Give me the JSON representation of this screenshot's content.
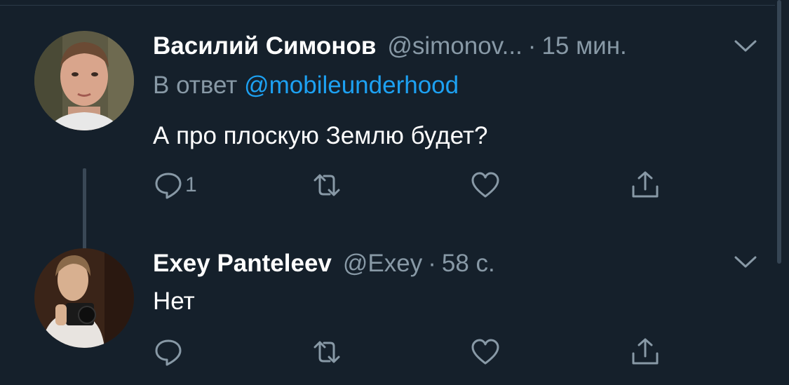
{
  "tweets": [
    {
      "author_name": "Василий Симонов",
      "author_handle": "@simonov...",
      "separator": "·",
      "time": "15 мин.",
      "reply_prefix": "В ответ",
      "reply_mention": "@mobileunderhood",
      "text": "А про плоскую Землю будет?",
      "reply_count": "1",
      "avatar": "person-photo-avatar",
      "icons": [
        "reply-icon",
        "retweet-icon",
        "like-icon",
        "share-icon",
        "chevron-down-icon"
      ]
    },
    {
      "author_name": "Exey Panteleev",
      "author_handle": "@Exey",
      "separator": "·",
      "time": "58 с.",
      "text": "Нет",
      "avatar": "person-with-camera-avatar",
      "icons": [
        "reply-icon",
        "retweet-icon",
        "like-icon",
        "share-icon",
        "chevron-down-icon"
      ]
    }
  ],
  "colors": {
    "background": "#15202b",
    "primary_text": "#ffffff",
    "secondary_text": "#8899a6",
    "accent": "#1da1f2",
    "thread_line": "#3a4856"
  }
}
